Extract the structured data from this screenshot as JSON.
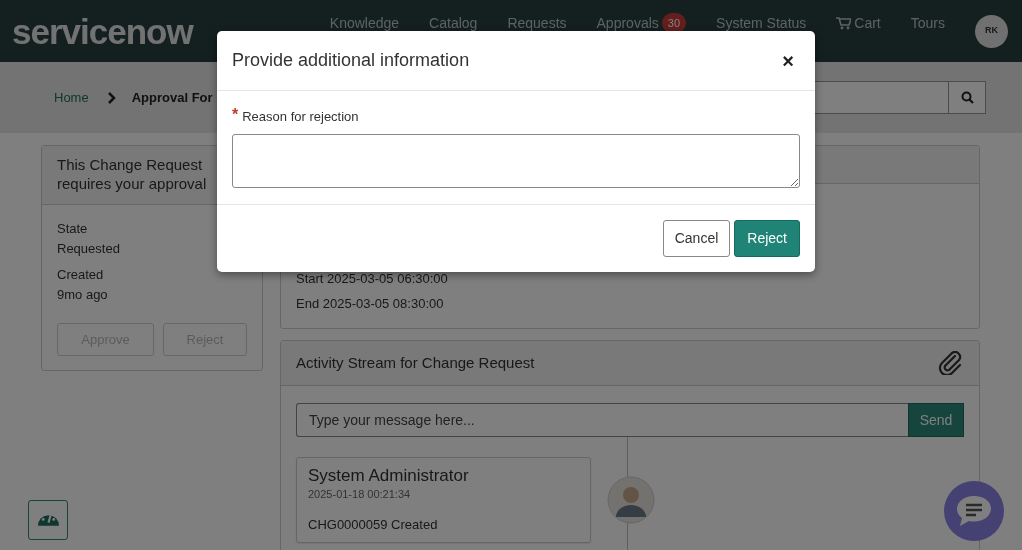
{
  "header": {
    "logo": "servicenow",
    "nav": [
      {
        "label": "Knowledge"
      },
      {
        "label": "Catalog"
      },
      {
        "label": "Requests"
      },
      {
        "label": "Approvals",
        "badge": "30"
      },
      {
        "label": "System Status"
      },
      {
        "label": "Cart",
        "kind": "cart"
      },
      {
        "label": "Tours"
      }
    ],
    "avatar": "RK"
  },
  "breadcrumb": [
    {
      "label": "Home",
      "selected": false
    },
    {
      "label": "Approval For",
      "selected": true
    }
  ],
  "approval_card": {
    "title": "This Change Request requires your approval",
    "fields": [
      {
        "label": "State",
        "value": "Requested"
      },
      {
        "label": "Created",
        "value": "9mo ago"
      }
    ],
    "buttons": [
      {
        "label": "Approve",
        "disabled": true
      },
      {
        "label": "Reject",
        "disabled": true
      }
    ]
  },
  "details": {
    "lines": [
      "Start 2025-03-05 06:30:00",
      "End 2025-03-05 08:30:00"
    ]
  },
  "activity": {
    "title": "Activity Stream for Change Request",
    "message_placeholder": "Type your message here...",
    "send": "Send",
    "entries": [
      {
        "author": "System Administrator",
        "time": "2025-01-18 00:21:34",
        "text": "CHG0000059 Created"
      }
    ]
  },
  "modal": {
    "title": "Provide additional information",
    "close": "×",
    "required_mark": "*",
    "field_label": "Reason for rejection",
    "buttons": [
      {
        "label": "Cancel",
        "kind": "secondary"
      },
      {
        "label": "Reject",
        "kind": "primary"
      }
    ]
  }
}
